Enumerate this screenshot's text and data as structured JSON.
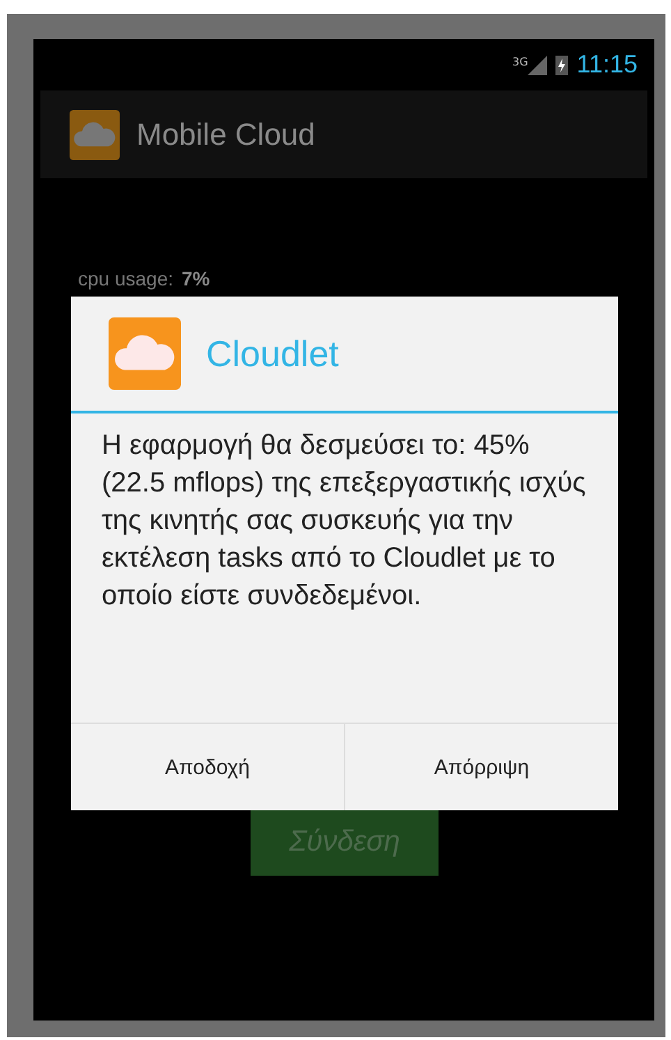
{
  "status_bar": {
    "network": "3G",
    "time": "11:15"
  },
  "action_bar": {
    "title": "Mobile Cloud"
  },
  "content": {
    "cpu_label": "cpu usage:",
    "cpu_value": "7%",
    "connect_button": "Σύνδεση"
  },
  "dialog": {
    "title": "Cloudlet",
    "message": "Η εφαρμογή θα δεσμεύσει το: 45% (22.5 mflops) της επεξεργαστικής ισχύς της κινητής σας συσκευής για την εκτέλεση tasks από το Cloudlet με το οποίο είστε συνδεδεμένοι.",
    "buttons": [
      "Αποδοχή",
      "Απόρριψη"
    ]
  }
}
